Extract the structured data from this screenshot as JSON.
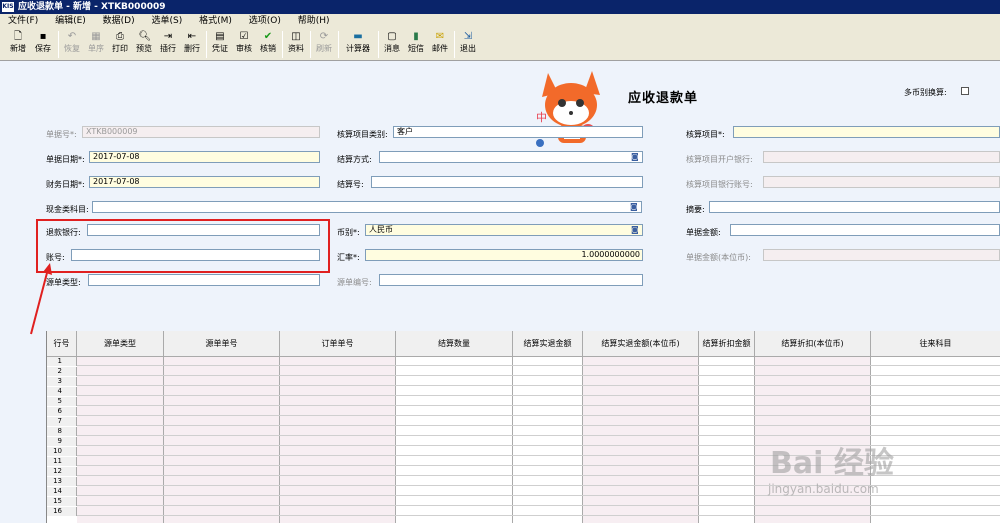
{
  "window": {
    "title": "应收退款单 - 新增 - XTKB000009",
    "app_icon": "KIS"
  },
  "menu": [
    "文件(F)",
    "编辑(E)",
    "数据(D)",
    "选单(S)",
    "格式(M)",
    "选项(O)",
    "帮助(H)"
  ],
  "toolbar": [
    {
      "label": "新增",
      "icon": "new-doc-icon",
      "disabled": false
    },
    {
      "label": "保存",
      "icon": "save-icon",
      "disabled": false
    },
    {
      "label": "恢复",
      "icon": "undo-icon",
      "disabled": true
    },
    {
      "label": "单序",
      "icon": "sort-icon",
      "disabled": true
    },
    {
      "label": "打印",
      "icon": "print-icon",
      "disabled": false
    },
    {
      "label": "预览",
      "icon": "preview-icon",
      "disabled": false
    },
    {
      "label": "插行",
      "icon": "insert-row-icon",
      "disabled": false
    },
    {
      "label": "删行",
      "icon": "delete-row-icon",
      "disabled": false
    },
    {
      "label": "凭证",
      "icon": "voucher-icon",
      "disabled": false
    },
    {
      "label": "审核",
      "icon": "audit-icon",
      "disabled": false
    },
    {
      "label": "核销",
      "icon": "checkmark-icon",
      "disabled": false
    },
    {
      "label": "资料",
      "icon": "data-icon",
      "disabled": false
    },
    {
      "label": "刷新",
      "icon": "refresh-icon",
      "disabled": true
    },
    {
      "label": "计算器",
      "icon": "calculator-icon",
      "disabled": false
    },
    {
      "label": "消息",
      "icon": "message-icon",
      "disabled": false
    },
    {
      "label": "短信",
      "icon": "sms-icon",
      "disabled": false
    },
    {
      "label": "邮件",
      "icon": "mail-icon",
      "disabled": false
    },
    {
      "label": "退出",
      "icon": "exit-icon",
      "disabled": false
    }
  ],
  "form": {
    "title": "应收退款单",
    "multi_currency_label": "多币别换算:",
    "doc_no_label": "单据号*:",
    "doc_no": "XTKB000009",
    "doc_date_label": "单据日期*:",
    "doc_date": "2017-07-08",
    "fin_date_label": "财务日期*:",
    "fin_date": "2017-07-08",
    "cash_account_label": "现金类科目:",
    "refund_bank_label": "退款银行:",
    "account_no_label": "账号:",
    "source_type_label": "源单类型:",
    "item_category_label": "核算项目类别:",
    "item_category": "客户",
    "settle_method_label": "结算方式:",
    "settle_no_label": "结算号:",
    "currency_label": "币别*:",
    "currency": "人民币",
    "rate_label": "汇率*:",
    "rate": "1.0000000000",
    "source_no_label": "源单编号:",
    "item_label": "核算项目*:",
    "item_bank_label": "核算项目开户银行:",
    "item_bank_acct_label": "核算项目银行账号:",
    "summary_label": "摘要:",
    "amount_label": "单据金额:",
    "amount_local_label": "单据金额(本位币):"
  },
  "grid": {
    "headers": [
      "行号",
      "源单类型",
      "源单单号",
      "订单单号",
      "结算数量",
      "结算实退金额",
      "结算实退金额(本位币)",
      "结算折扣金额",
      "结算折扣(本位币)",
      "往来科目"
    ],
    "rows": [
      "1",
      "2",
      "3",
      "4",
      "5",
      "6",
      "7",
      "8",
      "9",
      "10",
      "11",
      "12",
      "13",
      "14",
      "15",
      "16"
    ]
  },
  "watermark": {
    "brand": "Bai 经验",
    "url": "jingyan.baidu.com"
  },
  "mascot_text": "中"
}
